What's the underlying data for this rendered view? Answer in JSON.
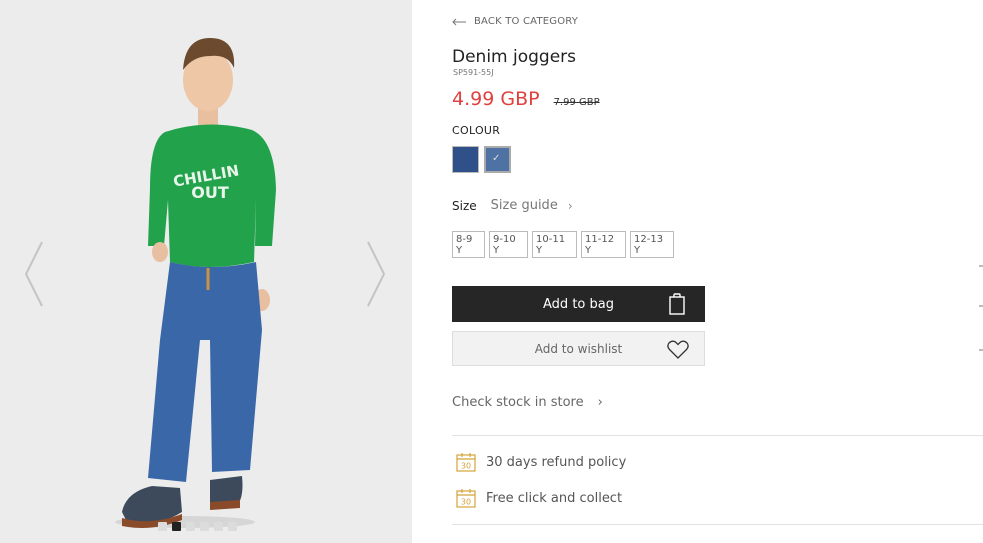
{
  "gallery": {
    "sweater_text": [
      "CHILLIN",
      "OUT"
    ],
    "prev_icon": "chevron-left-icon",
    "next_icon": "chevron-right-icon",
    "dots_count": 6,
    "active_dot": 1
  },
  "nav": {
    "back_label": "BACK TO CATEGORY",
    "back_icon": "arrow-left-icon"
  },
  "product": {
    "title": "Denim joggers",
    "sku": "SP591-55J",
    "price": "4.99 GBP",
    "old_price": "7.99 GBP",
    "price_color": "#e0413e"
  },
  "colour": {
    "label": "COLOUR",
    "swatches": [
      {
        "color": "#2f5088",
        "selected": false
      },
      {
        "color": "#4e72a3",
        "selected": true
      }
    ]
  },
  "size": {
    "label": "Size",
    "guide_label": "Size guide",
    "options": [
      "8-9 Y",
      "9-10 Y",
      "10-11 Y",
      "11-12 Y",
      "12-13 Y"
    ]
  },
  "actions": {
    "add_to_bag": "Add to bag",
    "add_to_wishlist": "Add to wishlist",
    "check_stock": "Check stock in store"
  },
  "perks": [
    {
      "icon": "calendar-30-icon",
      "label": "30 days refund policy",
      "icon_number": "30"
    },
    {
      "icon": "calendar-30-icon",
      "label": "Free click and collect",
      "icon_number": "30"
    }
  ]
}
